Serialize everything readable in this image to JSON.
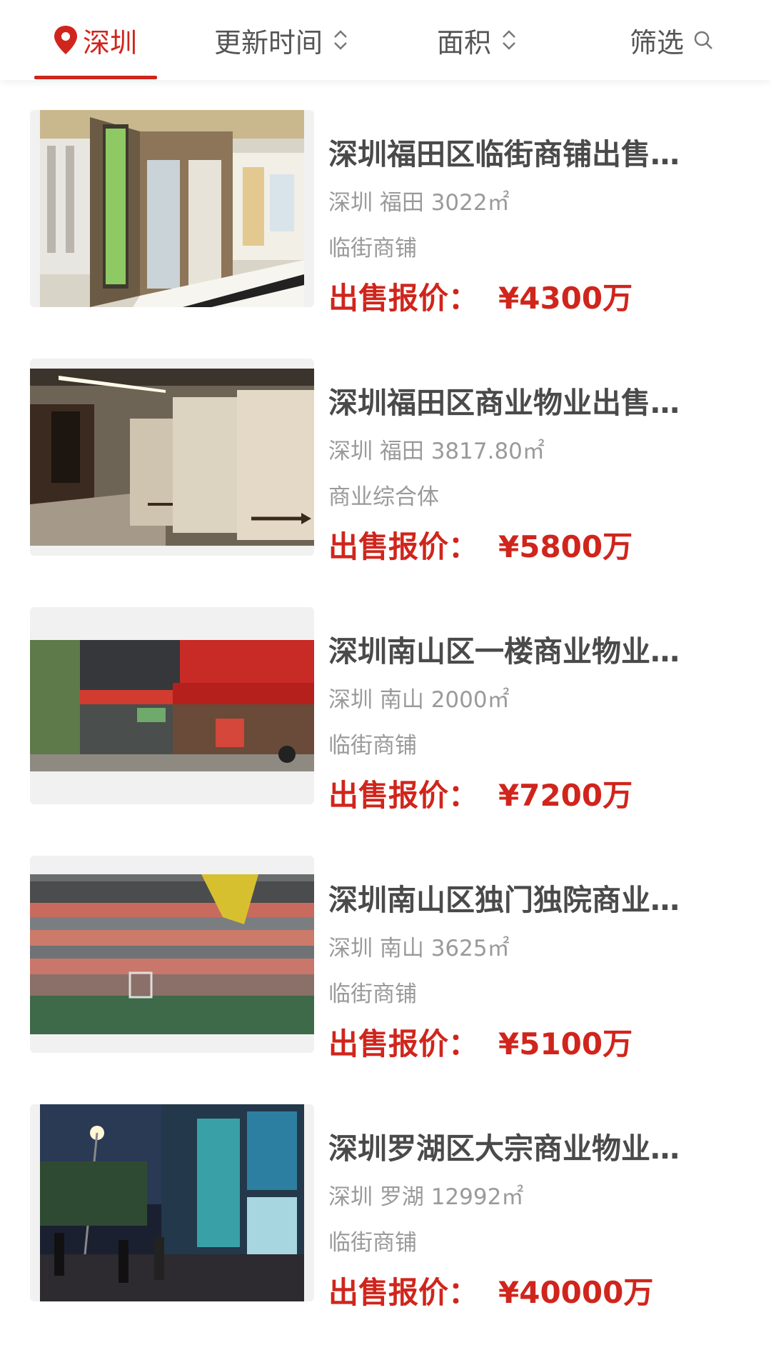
{
  "filter_bar": {
    "city": "深圳",
    "update_time": "更新时间",
    "area": "面积",
    "filter": "筛选"
  },
  "colors": {
    "accent": "#d0251c",
    "title": "#4a4a4a",
    "meta": "#9a9a9a"
  },
  "listings": [
    {
      "title": "深圳福田区临街商铺出售…",
      "meta": "深圳 福田 3022㎡",
      "type": "临街商铺",
      "price_label": "出售报价：",
      "price": "¥4300万",
      "photo": "storefront-beauty-salon-photo"
    },
    {
      "title": "深圳福田区商业物业出售…",
      "meta": "深圳 福田 3817.80㎡",
      "type": "商业综合体",
      "price_label": "出售报价：",
      "price": "¥5800万",
      "photo": "commercial-lobby-photo"
    },
    {
      "title": "深圳南山区一楼商业物业…",
      "meta": "深圳 南山 2000㎡",
      "type": "临街商铺",
      "price_label": "出售报价：",
      "price": "¥7200万",
      "photo": "street-shops-photo"
    },
    {
      "title": "深圳南山区独门独院商业…",
      "meta": "深圳 南山 3625㎡",
      "type": "临街商铺",
      "price_label": "出售报价：",
      "price": "¥5100万",
      "photo": "building-courtyard-photo"
    },
    {
      "title": "深圳罗湖区大宗商业物业…",
      "meta": "深圳 罗湖 12992㎡",
      "type": "临街商铺",
      "price_label": "出售报价：",
      "price": "¥40000万",
      "photo": "night-street-photo"
    }
  ]
}
